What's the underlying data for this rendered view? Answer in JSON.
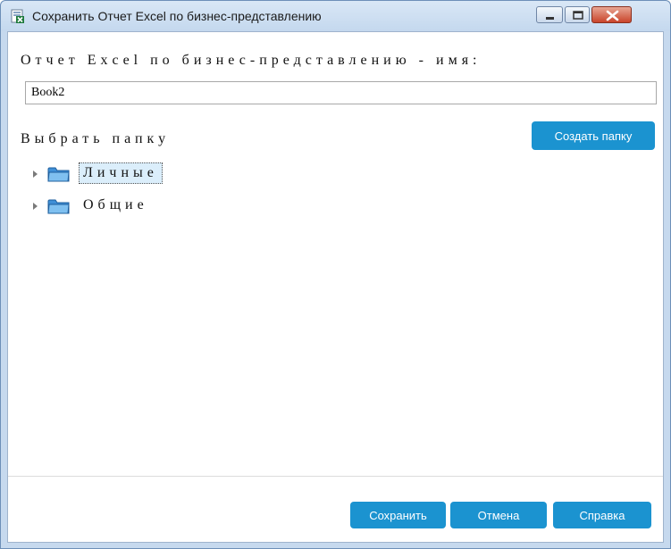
{
  "window": {
    "title": "Сохранить Отчет Excel по бизнес-представлению",
    "controls": {
      "minimize": "minimize",
      "maximize": "maximize",
      "close": "close"
    }
  },
  "form": {
    "name_label": "Отчет Excel по бизнес-представлению - имя:",
    "name_value": "Book2",
    "folder_label": "Выбрать папку",
    "create_folder_label": "Создать папку"
  },
  "tree": {
    "items": [
      {
        "label": "Личные",
        "selected": true
      },
      {
        "label": "Общие",
        "selected": false
      }
    ]
  },
  "footer": {
    "save_label": "Сохранить",
    "cancel_label": "Отмена",
    "help_label": "Справка"
  },
  "colors": {
    "accent_button": "#1b93d0",
    "selection": "#dbeefb",
    "title_bar": "#c6d9ee",
    "close_button": "#c9442a"
  },
  "icons": [
    "excel-report-icon",
    "folder-icon",
    "expand-arrow-icon",
    "minimize-icon",
    "maximize-icon",
    "close-icon"
  ]
}
